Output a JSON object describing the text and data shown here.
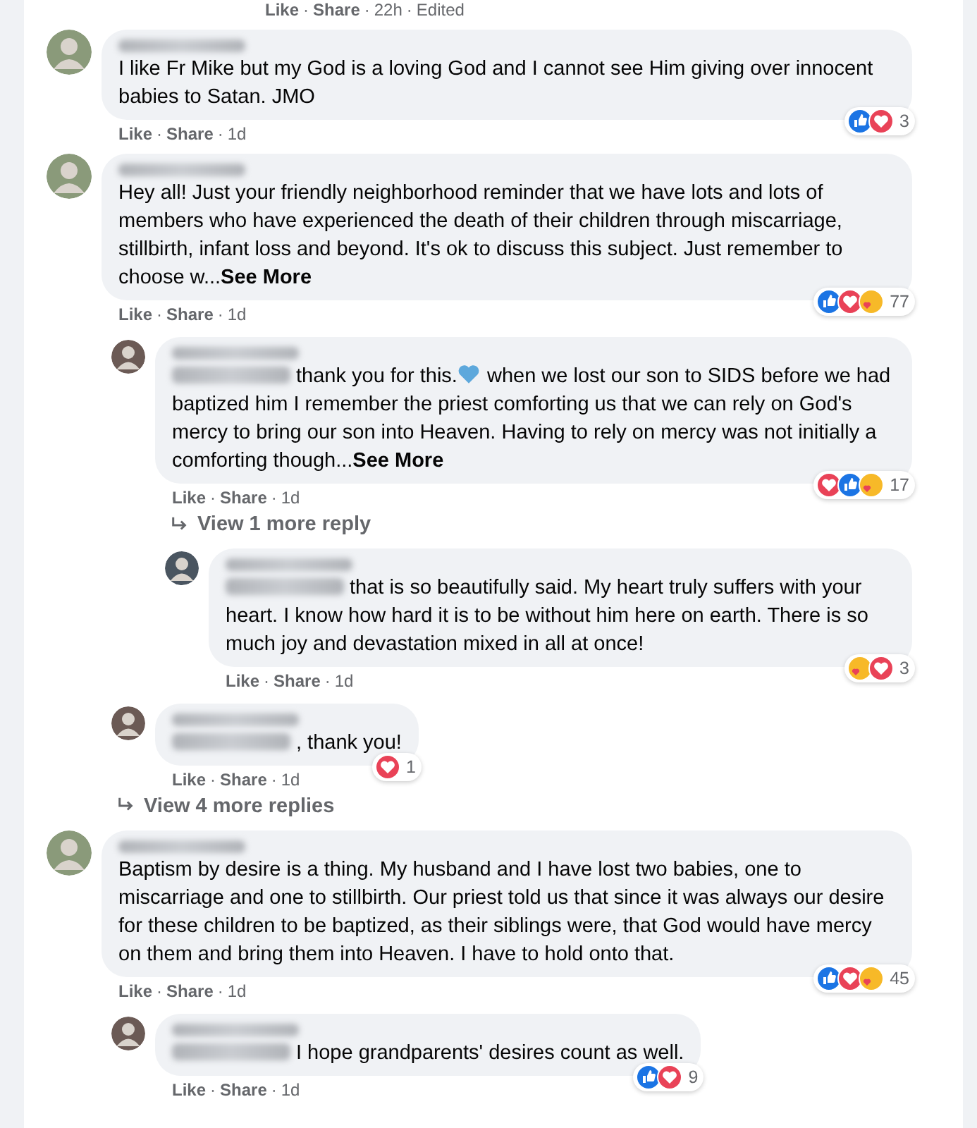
{
  "top_actions": [
    {
      "kind": "link",
      "text": "Like"
    },
    {
      "kind": "dot",
      "text": "·"
    },
    {
      "kind": "link",
      "text": "Share"
    },
    {
      "kind": "dot",
      "text": "·"
    },
    {
      "kind": "time",
      "text": "22h"
    },
    {
      "kind": "dot",
      "text": "·"
    },
    {
      "kind": "time",
      "text": "Edited"
    }
  ],
  "comments": [
    {
      "kind": "comment",
      "mention": false,
      "parts": [
        {
          "kind": "text",
          "text": "I like Fr Mike but my God is a loving God and I cannot see Him giving over innocent babies to Satan. JMO"
        }
      ],
      "actions": [
        {
          "kind": "link",
          "text": "Like"
        },
        {
          "kind": "dot",
          "text": "·"
        },
        {
          "kind": "link",
          "text": "Share"
        },
        {
          "kind": "dot",
          "text": "·"
        },
        {
          "kind": "time",
          "text": "1d"
        }
      ],
      "reactions": [
        {
          "kind": "like"
        },
        {
          "kind": "love"
        }
      ],
      "count": "3"
    },
    {
      "kind": "comment",
      "mention": false,
      "parts": [
        {
          "kind": "text",
          "text": "Hey all! Just your friendly neighborhood reminder that we have lots and lots of members who have experienced the death of their children through miscarriage, stillbirth, infant loss and beyond. It's ok to discuss this subject. Just remember to choose w..."
        }
      ],
      "see_more": "See More",
      "actions": [
        {
          "kind": "link",
          "text": "Like"
        },
        {
          "kind": "dot",
          "text": "·"
        },
        {
          "kind": "link",
          "text": "Share"
        },
        {
          "kind": "dot",
          "text": "·"
        },
        {
          "kind": "time",
          "text": "1d"
        }
      ],
      "reactions": [
        {
          "kind": "like"
        },
        {
          "kind": "love"
        },
        {
          "kind": "care"
        }
      ],
      "count": "77",
      "children": [
        {
          "kind": "comment",
          "mention": true,
          "parts": [
            {
              "kind": "text",
              "text": "thank you for this."
            },
            {
              "kind": "heart"
            },
            {
              "kind": "text",
              "text": " when we lost our son to SIDS before we had baptized him I remember the priest comforting us that we can rely on God's mercy to bring our son into Heaven. Having to rely on mercy was not initially a comforting though..."
            }
          ],
          "see_more": "See More",
          "actions": [
            {
              "kind": "link",
              "text": "Like"
            },
            {
              "kind": "dot",
              "text": "·"
            },
            {
              "kind": "link",
              "text": "Share"
            },
            {
              "kind": "dot",
              "text": "·"
            },
            {
              "kind": "time",
              "text": "1d"
            }
          ],
          "reactions": [
            {
              "kind": "love"
            },
            {
              "kind": "like"
            },
            {
              "kind": "care"
            }
          ],
          "count": "17",
          "children": [
            {
              "kind": "more",
              "text": "View 1 more reply"
            },
            {
              "kind": "comment",
              "mention": true,
              "parts": [
                {
                  "kind": "text",
                  "text": "that is so beautifully said. My heart truly suffers with your heart. I know how hard it is to be without him here on earth. There is so much joy and devastation mixed in all at once!"
                }
              ],
              "actions": [
                {
                  "kind": "link",
                  "text": "Like"
                },
                {
                  "kind": "dot",
                  "text": "·"
                },
                {
                  "kind": "link",
                  "text": "Share"
                },
                {
                  "kind": "dot",
                  "text": "·"
                },
                {
                  "kind": "time",
                  "text": "1d"
                }
              ],
              "reactions": [
                {
                  "kind": "care"
                },
                {
                  "kind": "love"
                }
              ],
              "count": "3"
            }
          ]
        },
        {
          "kind": "comment",
          "mention": true,
          "parts": [
            {
              "kind": "text",
              "text": ", thank you!"
            }
          ],
          "actions": [
            {
              "kind": "link",
              "text": "Like"
            },
            {
              "kind": "dot",
              "text": "·"
            },
            {
              "kind": "link",
              "text": "Share"
            },
            {
              "kind": "dot",
              "text": "·"
            },
            {
              "kind": "time",
              "text": "1d"
            }
          ],
          "reactions": [
            {
              "kind": "love"
            }
          ],
          "count": "1"
        },
        {
          "kind": "more",
          "text": "View 4 more replies"
        }
      ]
    },
    {
      "kind": "comment",
      "mention": false,
      "parts": [
        {
          "kind": "text",
          "text": "Baptism by desire is a thing. My husband and I have lost two babies, one to miscarriage and one to stillbirth. Our priest told us that since it was always our desire for these children to be baptized, as their siblings were, that God would have mercy on them and bring them into Heaven. I have to hold onto that."
        }
      ],
      "actions": [
        {
          "kind": "link",
          "text": "Like"
        },
        {
          "kind": "dot",
          "text": "·"
        },
        {
          "kind": "link",
          "text": "Share"
        },
        {
          "kind": "dot",
          "text": "·"
        },
        {
          "kind": "time",
          "text": "1d"
        }
      ],
      "reactions": [
        {
          "kind": "like"
        },
        {
          "kind": "love"
        },
        {
          "kind": "care"
        }
      ],
      "count": "45",
      "children": [
        {
          "kind": "comment",
          "mention": true,
          "parts": [
            {
              "kind": "text",
              "text": "I hope grandparents' desires count as well."
            }
          ],
          "actions": [
            {
              "kind": "link",
              "text": "Like"
            },
            {
              "kind": "dot",
              "text": "·"
            },
            {
              "kind": "link",
              "text": "Share"
            },
            {
              "kind": "dot",
              "text": "·"
            },
            {
              "kind": "time",
              "text": "1d"
            }
          ],
          "reactions": [
            {
              "kind": "like"
            },
            {
              "kind": "love"
            }
          ],
          "count": "9"
        }
      ]
    }
  ]
}
